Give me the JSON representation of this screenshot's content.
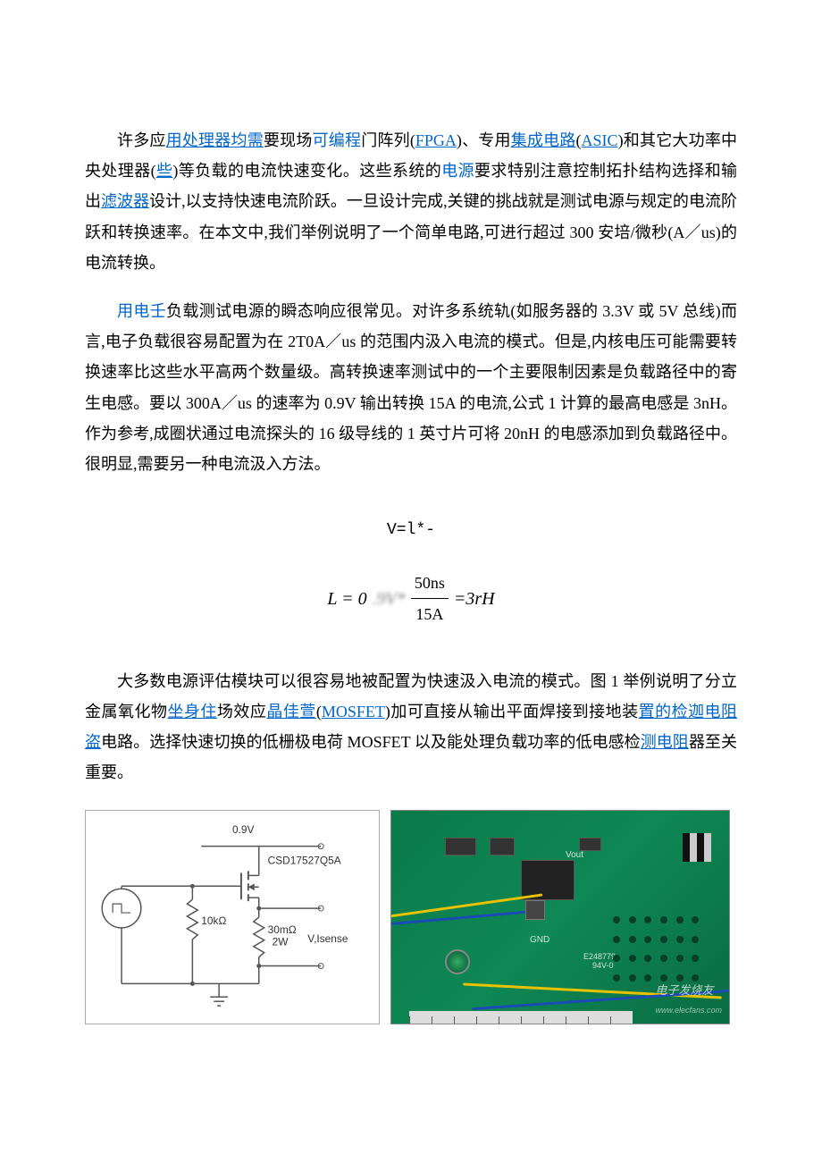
{
  "para1": {
    "t1": "许多应",
    "link1": "用处理器均需",
    "t2": "要现场",
    "blue1": "可编程",
    "t3": "门阵列(",
    "link2": "FPGA",
    "t4": ")、专用",
    "link3": "集成电路",
    "t5": "(",
    "link4": "ASIC",
    "t6": ")和其它大功率中央处理器(",
    "link5": "些",
    "t7": ")等负载的电流快速变化。这些系统的",
    "blue2": "电源",
    "t8": "要求特别注意控制拓扑结构选择和输出",
    "link6": "滤波器",
    "t9": "设计,以支持快速电流阶跃。一旦设计完成,关键的挑战就是测试电源与规定的电流阶跃和转换速率。在本文中,我们举例说明了一个简单电路,可进行超过 300 安培/微秒(A／us)的电流转换。"
  },
  "para2": {
    "blue1": "用电壬",
    "t1": "负载测试电源的瞬态响应很常见。对许多系统轨(如服务器的 3.3V 或 5V 总线)而言,电子负载很容易配置为在 2T0A／us 的范围内汲入电流的模式。但是,内核电压可能需要转换速率比这些水平高两个数量级。高转换速率测试中的一个主要限制因素是负载路径中的寄生电感。要以 300A／us 的速率为 0.9V 输出转换 15A 的电流,公式 1 计算的最高电感是 3nH。作为参考,成圈状通过电流探头的 16 级导线的 1 英寸片可将 20nH 的电感添加到负载路径中。很明显,需要另一种电流汲入方法。"
  },
  "formula": {
    "line1": "V=l*-",
    "lhs": "L = 0",
    "blurred": ".9V*",
    "num": "50ns",
    "den": "15A",
    "rhs": "=3rH"
  },
  "para3": {
    "t1": "大多数电源评估模块可以很容易地被配置为快速汲入电流的模式。图 1 举例说明了分立金属氧化物",
    "link1": "坐身住",
    "t2": "场效应",
    "link2": "晶佳萱",
    "t3": "(",
    "link3": "MOSFET",
    "t4": ")加可直接从输出平面焊接到接地装",
    "link4": "置的检迦电阻盗",
    "t5": "电路。选择快速切换的低栅极电荷 MOSFET 以及能处理负载功率的低电感检",
    "link5": "测电阻",
    "t6": "器至关重要。"
  },
  "schematic": {
    "voltage": "0.9V",
    "part": "CSD17527Q5A",
    "r1": "10kΩ",
    "r2_val": "30mΩ",
    "r2_pow": "2W",
    "out1": "V,Isense"
  },
  "pcb": {
    "vout": "Vout",
    "gnd": "GND",
    "silkscreen": "E248779",
    "rev": "94V-0",
    "watermark_cn": "电子发烧友",
    "watermark_en": "www.elecfans.com"
  }
}
